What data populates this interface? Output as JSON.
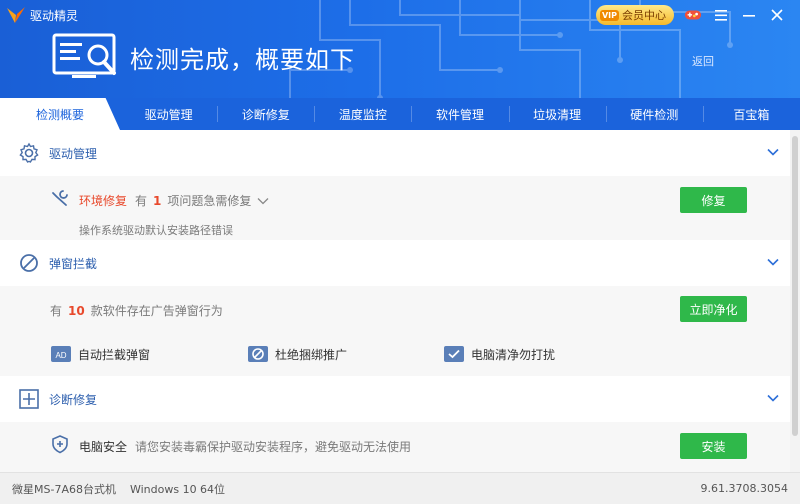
{
  "app": {
    "name": "驱动精灵"
  },
  "titlebar": {
    "vip_label": "会员中心",
    "vip_badge": "VIP"
  },
  "header": {
    "headline": "检测完成，概要如下",
    "back_label": "返回"
  },
  "tabs": [
    {
      "label": "检测概要",
      "active": true
    },
    {
      "label": "驱动管理"
    },
    {
      "label": "诊断修复"
    },
    {
      "label": "温度监控"
    },
    {
      "label": "软件管理"
    },
    {
      "label": "垃圾清理"
    },
    {
      "label": "硬件检测"
    },
    {
      "label": "百宝箱"
    }
  ],
  "sections": {
    "driver": {
      "title": "驱动管理",
      "item_name": "环境修复",
      "item_prefix": "有",
      "item_count": "1",
      "item_suffix": "项问题急需修复",
      "item_desc": "操作系统驱动默认安装路径错误",
      "action": "修复"
    },
    "popup": {
      "title": "弹窗拦截",
      "prefix": "有",
      "count": "10",
      "suffix": "款软件存在广告弹窗行为",
      "action": "立即净化",
      "features": [
        "自动拦截弹窗",
        "杜绝捆绑推广",
        "电脑清净勿打扰"
      ]
    },
    "diagnose": {
      "title": "诊断修复",
      "item_name": "电脑安全",
      "item_desc": "请您安装毒霸保护驱动安装程序，避免驱动无法使用",
      "action": "安装"
    }
  },
  "footer": {
    "machine": "微星MS-7A68台式机",
    "os": "Windows 10 64位",
    "version": "9.61.3708.3054"
  },
  "colors": {
    "primary": "#1b63dc",
    "action_green": "#2fb84a",
    "highlight_red": "#e8492c"
  }
}
